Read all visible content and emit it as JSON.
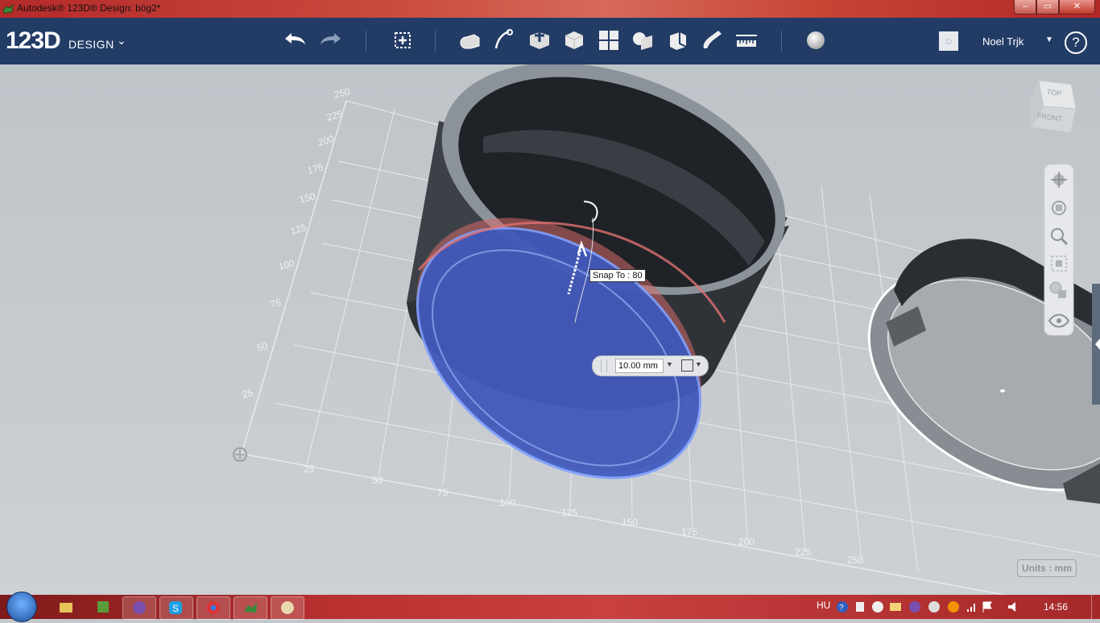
{
  "window": {
    "title": "Autodesk® 123D® Design: bög2*",
    "controls": [
      "minimize",
      "maximize",
      "close"
    ]
  },
  "app": {
    "logo_main": "123D",
    "logo_sub": "DESIGN"
  },
  "toolbar": {
    "tools": [
      "undo-icon",
      "redo-icon",
      "transform-icon",
      "primitives-icon",
      "sketch-icon",
      "construct-icon",
      "modify-icon",
      "pattern-icon",
      "grouping-icon",
      "combine-icon",
      "snap-icon",
      "measure-icon",
      "material-icon"
    ]
  },
  "user": {
    "name": "Noel Trjk",
    "help": "?"
  },
  "viewcube": {
    "top": "TOP",
    "front": "FRONT"
  },
  "grid": {
    "x_labels": [
      "25",
      "50",
      "75",
      "100",
      "125",
      "150",
      "175",
      "200",
      "225",
      "250"
    ],
    "y_labels": [
      "25",
      "50",
      "75",
      "100",
      "125",
      "150",
      "175",
      "200",
      "225",
      "250"
    ]
  },
  "tooltip": {
    "snap": "Snap To : 80"
  },
  "input": {
    "value": "10.00 mm"
  },
  "units": {
    "label": "Units : mm"
  },
  "taskbar": {
    "language": "HU",
    "time": "14:56"
  },
  "colors": {
    "toolbar_bg": "#233c66",
    "selection_blue": "#3a5fc4",
    "taskbar_red": "#b83030"
  }
}
